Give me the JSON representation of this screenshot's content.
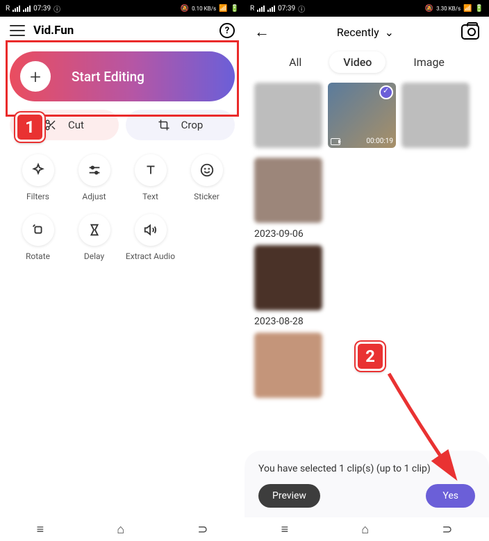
{
  "status": {
    "time": "07:39",
    "carrier": "R",
    "data": "0.10 KB/s",
    "data2": "3.30 KB/s",
    "bat": "100"
  },
  "left": {
    "title": "Vid.Fun",
    "start": "Start Editing",
    "cut": "Cut",
    "crop": "Crop",
    "tools": [
      "Filters",
      "Adjust",
      "Text",
      "Sticker",
      "Rotate",
      "Delay",
      "Extract Audio"
    ]
  },
  "right": {
    "sort": "Recently",
    "tabs": {
      "all": "All",
      "video": "Video",
      "image": "Image"
    },
    "dur": "00:00:19",
    "date1": "2023-09-06",
    "date2": "2023-08-28",
    "sheetText": "You have selected 1 clip(s) (up to 1 clip)",
    "preview": "Preview",
    "yes": "Yes"
  },
  "callouts": {
    "c1": "1",
    "c2": "2"
  }
}
